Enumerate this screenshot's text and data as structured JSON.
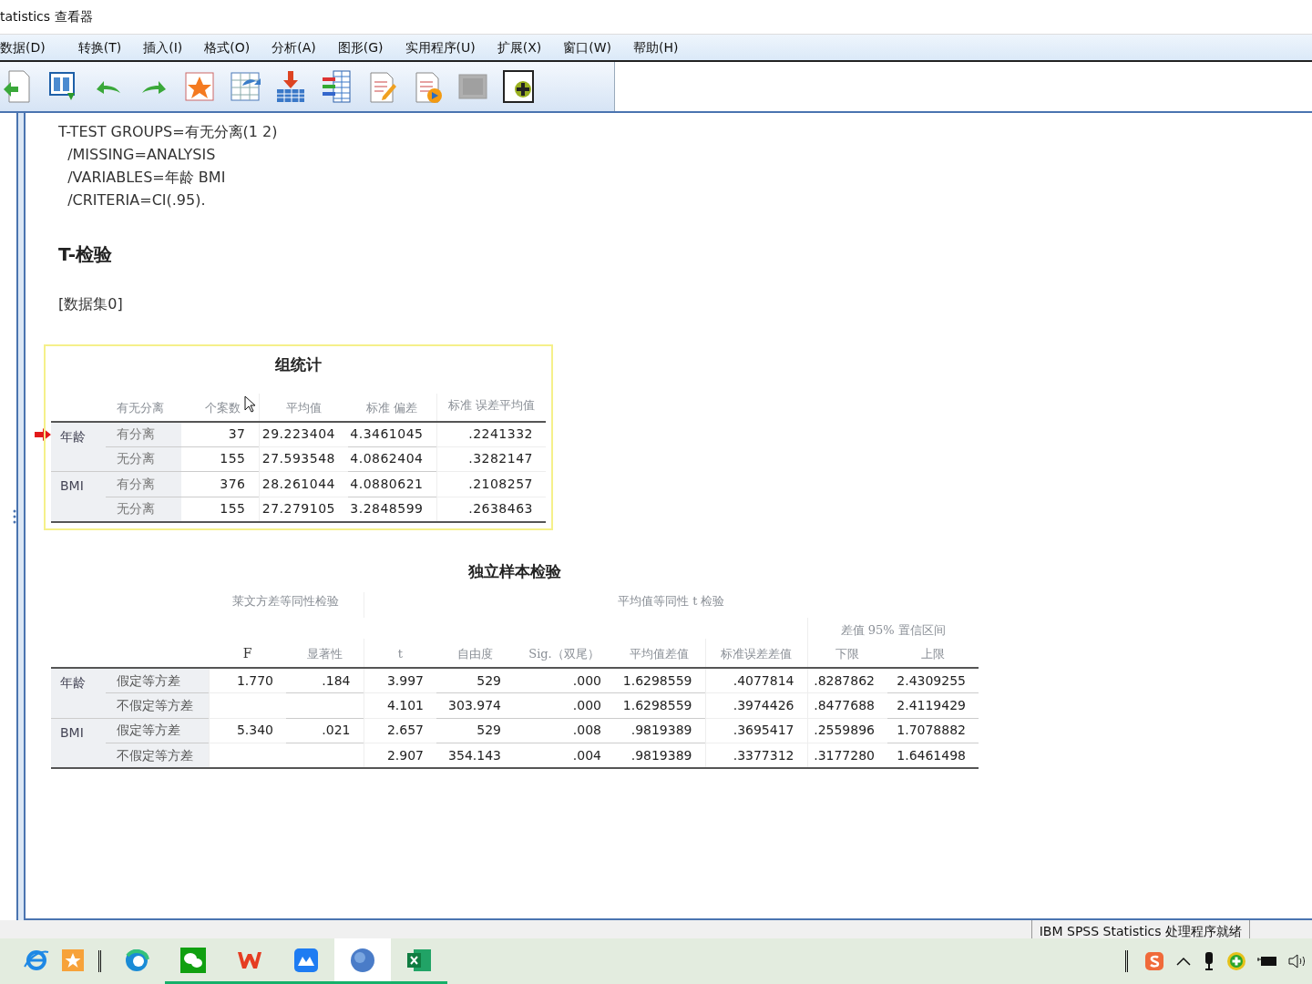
{
  "window": {
    "title": "tatistics 查看器"
  },
  "menu": [
    "数据(D)",
    "转换(T)",
    "插入(I)",
    "格式(O)",
    "分析(A)",
    "图形(G)",
    "实用程序(U)",
    "扩展(X)",
    "窗口(W)",
    "帮助(H)"
  ],
  "output": {
    "syntax": [
      "T-TEST GROUPS=有无分离(1 2)",
      "  /MISSING=ANALYSIS",
      "  /VARIABLES=年龄 BMI",
      "  /CRITERIA=CI(.95)."
    ],
    "heading": "T-检验",
    "dataset": "[数据集0]",
    "group_stats": {
      "selected": true,
      "title": "组统计",
      "columns": [
        "有无分离",
        "个案数",
        "平均值",
        "标准 偏差",
        "标准 误差平均值"
      ],
      "rows": [
        {
          "variable": "年龄",
          "label": "有分离",
          "values": [
            "37",
            "29.223404",
            "4.3461045",
            ".2241332"
          ]
        },
        {
          "label": "无分离",
          "values": [
            "155",
            "27.593548",
            "4.0862404",
            ".3282147"
          ]
        },
        {
          "variable": "BMI",
          "label": "有分离",
          "values": [
            "376",
            "28.261044",
            "4.0880621",
            ".2108257"
          ]
        },
        {
          "label": "无分离",
          "values": [
            "155",
            "27.279105",
            "3.2848599",
            ".2638463"
          ]
        }
      ]
    },
    "independent_test": {
      "title": "独立样本检验",
      "group_headers": [
        "莱文方差等同性检验",
        "平均值等同性 t 检验"
      ],
      "ci_header": "差值 95% 置信区间",
      "columns": [
        "F",
        "显著性",
        "t",
        "自由度",
        "Sig.（双尾）",
        "平均值差值",
        "标准误差差值",
        "下限",
        "上限"
      ],
      "rows": [
        {
          "variable": "年龄",
          "label": "假定等方差",
          "levene": [
            "1.770",
            ".184"
          ],
          "values": [
            "3.997",
            "529",
            ".000",
            "1.6298559",
            ".4077814",
            ".8287862",
            "2.4309255"
          ]
        },
        {
          "label": "不假定等方差",
          "values": [
            "4.101",
            "303.974",
            ".000",
            "1.6298559",
            ".3974426",
            ".8477688",
            "2.4119429"
          ]
        },
        {
          "variable": "BMI",
          "label": "假定等方差",
          "levene": [
            "5.340",
            ".021"
          ],
          "values": [
            "2.657",
            "529",
            ".008",
            ".9819389",
            ".3695417",
            ".2559896",
            "1.7078882"
          ]
        },
        {
          "label": "不假定等方差",
          "values": [
            "2.907",
            "354.143",
            ".004",
            ".9819389",
            ".3377312",
            ".3177280",
            "1.6461498"
          ]
        }
      ]
    }
  },
  "status_bar": {
    "message": "IBM SPSS Statistics 处理程序就绪"
  },
  "taskbar": {
    "apps": [
      {
        "running": false,
        "selected": false
      },
      {
        "running": false,
        "selected": false
      },
      {
        "running": false,
        "selected": false
      },
      {
        "running": true,
        "selected": false
      },
      {
        "running": true,
        "selected": false
      },
      {
        "running": true,
        "selected": false
      },
      {
        "running": true,
        "selected": true
      },
      {
        "running": true,
        "selected": false
      }
    ]
  }
}
